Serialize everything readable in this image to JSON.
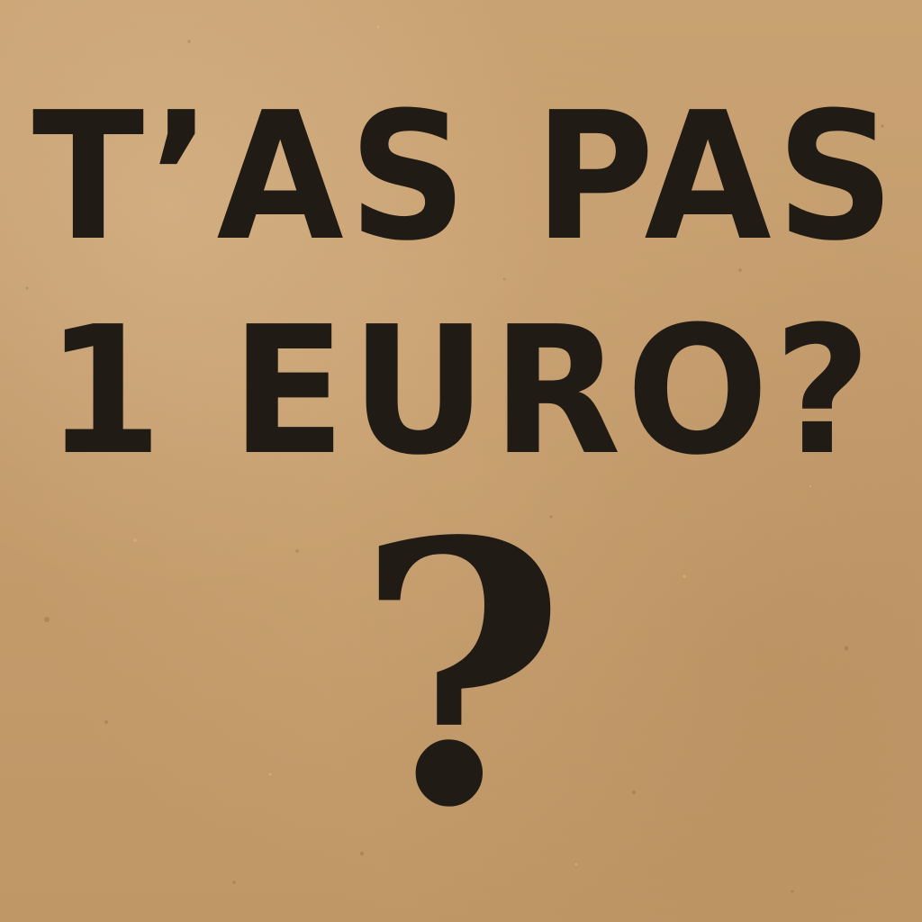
{
  "sign": {
    "line1": "T’AS PAS",
    "line2": "1 EURO?",
    "line3": "?"
  },
  "colors": {
    "cardboard": "#c29a6b",
    "ink": "#211b15"
  }
}
